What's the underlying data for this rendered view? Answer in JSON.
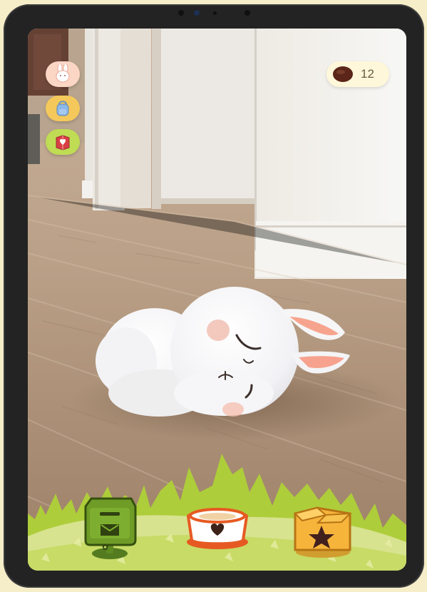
{
  "status": {
    "coins": "12"
  },
  "icons": {
    "rabbit": "rabbit-icon",
    "backpack": "backpack-icon",
    "journal": "heart-book-icon",
    "coin": "coin-icon",
    "mailbox": "mailbox-icon",
    "food_bowl": "pet-bowl-icon",
    "gift_box": "star-box-icon"
  },
  "colors": {
    "frame": "#232323",
    "grass": "#b9d545",
    "rabbit": "#f7f7f8",
    "ear": "#f6a28e",
    "coin": "#6a2c1f",
    "mailbox": "#6f9b27",
    "box": "#f6b43b"
  }
}
